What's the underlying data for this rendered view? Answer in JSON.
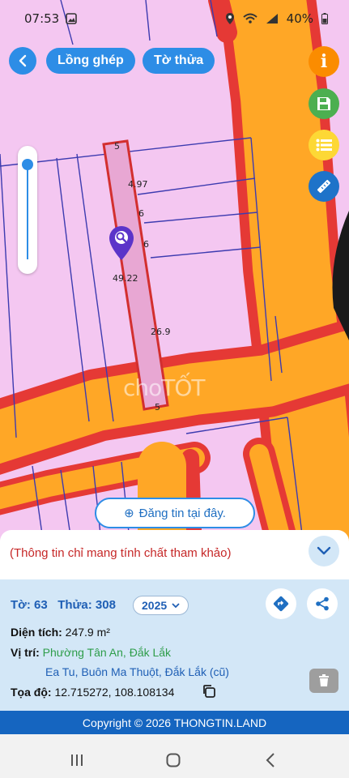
{
  "status": {
    "time": "07:53",
    "battery": "40%"
  },
  "toolbar": {
    "merge_label": "Lồng ghép",
    "sheet_label": "Tờ thửa"
  },
  "map": {
    "dimensions": [
      "5",
      "4.97",
      "6",
      "6",
      "49.22",
      "26.9",
      "5"
    ],
    "watermark": "choTỐT"
  },
  "post_button": {
    "icon": "⊕",
    "label": "Đăng tin tại đây."
  },
  "banner": {
    "note": "(Thông tin chỉ mang tính chất tham khảo)"
  },
  "detail": {
    "sheet_label": "Tờ:",
    "sheet_value": "63",
    "parcel_label": "Thửa:",
    "parcel_value": "308",
    "year": "2025",
    "area_label": "Diện tích:",
    "area_value": "247.9 m²",
    "location_label": "Vị trí:",
    "location_line1": "Phường Tân An, Đắk Lắk",
    "location_line2": "Ea Tu, Buôn Ma Thuột, Đắk Lắk (cũ)",
    "coord_label": "Tọa độ:",
    "coord_value": "12.715272, 108.108134"
  },
  "footer": {
    "copyright": "Copyright © 2026 THONGTIN.LAND"
  },
  "colors": {
    "accent": "#2d8de6",
    "road": "#ffa726",
    "road_edge": "#e53935",
    "land": "#f4c7f1"
  },
  "icons": [
    "back-icon",
    "info-icon",
    "save-icon",
    "list-icon",
    "ruler-icon",
    "location-pin-icon",
    "directions-icon",
    "share-icon",
    "trash-icon",
    "copy-icon",
    "chevron-down-icon"
  ]
}
